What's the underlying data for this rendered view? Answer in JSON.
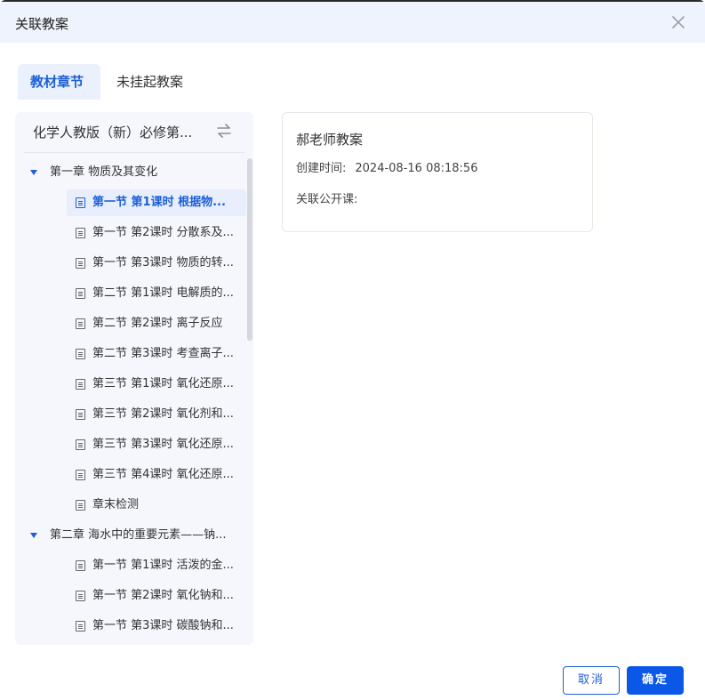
{
  "dialog": {
    "title": "关联教案",
    "close_icon": "close-icon"
  },
  "tabs": [
    {
      "label": "教材章节",
      "active": true
    },
    {
      "label": "未挂起教案",
      "active": false
    }
  ],
  "tree": {
    "book_name": "化学人教版（新）必修第...",
    "swap_icon": "swap-icon",
    "items": [
      {
        "type": "chapter",
        "label": "第一章 物质及其变化"
      },
      {
        "type": "lesson",
        "label": "第一节 第1课时 根据物...",
        "selected": true
      },
      {
        "type": "lesson",
        "label": "第一节 第2课时 分散系及..."
      },
      {
        "type": "lesson",
        "label": "第一节 第3课时 物质的转..."
      },
      {
        "type": "lesson",
        "label": "第二节 第1课时 电解质的..."
      },
      {
        "type": "lesson",
        "label": "第二节 第2课时 离子反应"
      },
      {
        "type": "lesson",
        "label": "第二节 第3课时 考查离子..."
      },
      {
        "type": "lesson",
        "label": "第三节 第1课时 氧化还原..."
      },
      {
        "type": "lesson",
        "label": "第三节 第2课时 氧化剂和..."
      },
      {
        "type": "lesson",
        "label": "第三节 第3课时 氧化还原..."
      },
      {
        "type": "lesson",
        "label": "第三节 第4课时 氧化还原..."
      },
      {
        "type": "lesson",
        "label": "章末检测"
      },
      {
        "type": "chapter",
        "label": "第二章 海水中的重要元素——钠..."
      },
      {
        "type": "lesson",
        "label": "第一节 第1课时 活泼的金..."
      },
      {
        "type": "lesson",
        "label": "第一节 第2课时 氧化钠和..."
      },
      {
        "type": "lesson",
        "label": "第一节 第3课时 碳酸钠和..."
      }
    ]
  },
  "card": {
    "name": "郝老师教案",
    "created_label": "创建时间:",
    "created_value": "2024-08-16 08:18:56",
    "public_label": "关联公开课:",
    "public_value": ""
  },
  "footer": {
    "cancel_label": "取消",
    "ok_label": "确定"
  },
  "colors": {
    "accent": "#1d5fd6",
    "primary_button": "#0b58e8",
    "header_bg": "#eef3fd",
    "panel_bg": "#f5f7fc"
  }
}
